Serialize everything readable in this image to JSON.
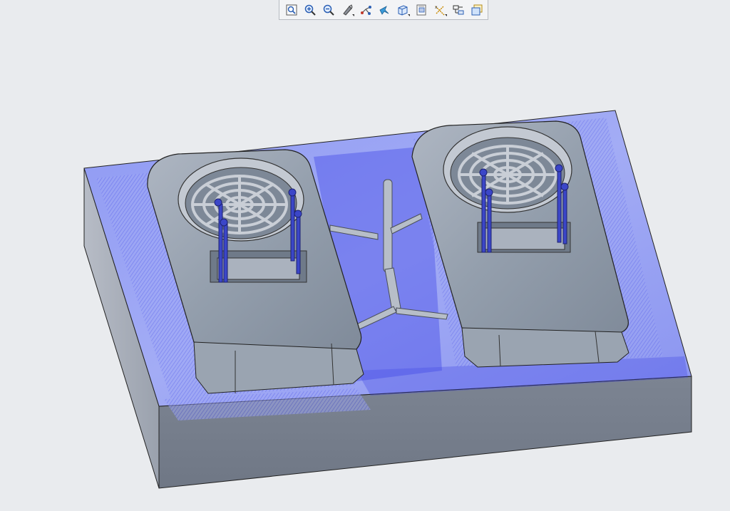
{
  "toolbar": {
    "buttons": [
      {
        "icon": "refit-icon",
        "name": "refit-button",
        "flyout": false
      },
      {
        "icon": "zoom-in-icon",
        "name": "zoom-in-button",
        "flyout": false
      },
      {
        "icon": "zoom-out-icon",
        "name": "zoom-out-button",
        "flyout": false
      },
      {
        "icon": "repaint-icon",
        "name": "repaint-button",
        "flyout": true
      },
      {
        "icon": "datum-display-icon",
        "name": "datum-display-button",
        "flyout": false
      },
      {
        "icon": "spin-center-icon",
        "name": "spin-center-button",
        "flyout": false
      },
      {
        "icon": "display-style-icon",
        "name": "display-style-button",
        "flyout": true
      },
      {
        "icon": "saved-views-icon",
        "name": "saved-views-button",
        "flyout": false
      },
      {
        "icon": "axis-display-icon",
        "name": "axis-display-button",
        "flyout": true
      },
      {
        "icon": "annotation-display-icon",
        "name": "annotation-display-button",
        "flyout": false
      },
      {
        "icon": "view-manager-icon",
        "name": "view-manager-button",
        "flyout": false
      }
    ]
  },
  "colors": {
    "background": "#e9ebee",
    "mold_top": "#9aa3f0",
    "mold_shade": "#3a3fe0",
    "mold_side": "#8a909c",
    "part_body": "#8c97a6",
    "part_light": "#b5bdc8",
    "pin": "#3b46c8"
  }
}
